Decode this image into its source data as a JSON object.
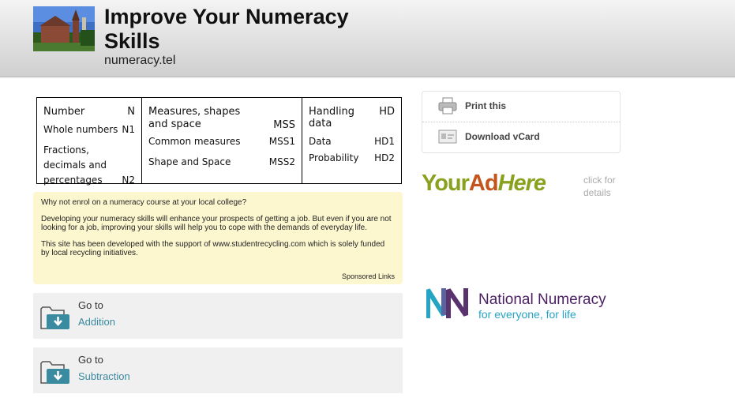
{
  "header": {
    "title": "Improve Your Numeracy Skills",
    "subtitle": "numeracy.tel"
  },
  "codes_table": {
    "number": {
      "heading": "Number",
      "heading_code": "N",
      "items": [
        {
          "label": "Whole numbers",
          "code": "N1"
        },
        {
          "label": "Fractions, decimals and percentages",
          "code": "N2"
        }
      ]
    },
    "measures": {
      "heading": "Measures, shapes and space",
      "heading_code": "MSS",
      "items": [
        {
          "label": "Common measures",
          "code": "MSS1"
        },
        {
          "label": "Shape and Space",
          "code": "MSS2"
        }
      ]
    },
    "handling": {
      "heading": "Handling data",
      "heading_code": "HD",
      "items": [
        {
          "label": "Data",
          "code": "HD1"
        },
        {
          "label": "Probability",
          "code": "HD2"
        }
      ]
    }
  },
  "notice": {
    "line1": "Why not enrol on a numeracy course at your local college?",
    "para2": "Developing your numeracy skills will enhance your prospects of getting a job. But even if you are not looking for a job, improving your skills will help you to cope with the demands of everyday life.",
    "para3": "This site has been developed with the support of www.studentrecycling.com which is solely funded by local recycling initiatives.",
    "sponsored": "Sponsored Links"
  },
  "goto_items": [
    {
      "go": "Go to",
      "label": "Addition"
    },
    {
      "go": "Go to",
      "label": "Subtraction"
    }
  ],
  "actions": {
    "print": "Print this",
    "vcard": "Download vCard"
  },
  "ad": {
    "your": "Your",
    "ad": "Ad",
    "here": "Here",
    "click": "click for details"
  },
  "national_numeracy": {
    "name": "National Numeracy",
    "tagline": "for everyone, for life"
  },
  "colors": {
    "link": "#3a8aa0",
    "folder": "#3a8aa0",
    "notice_bg": "#fdf7cf",
    "nn_purple": "#4c2162",
    "nn_blue": "#25a4c3"
  }
}
